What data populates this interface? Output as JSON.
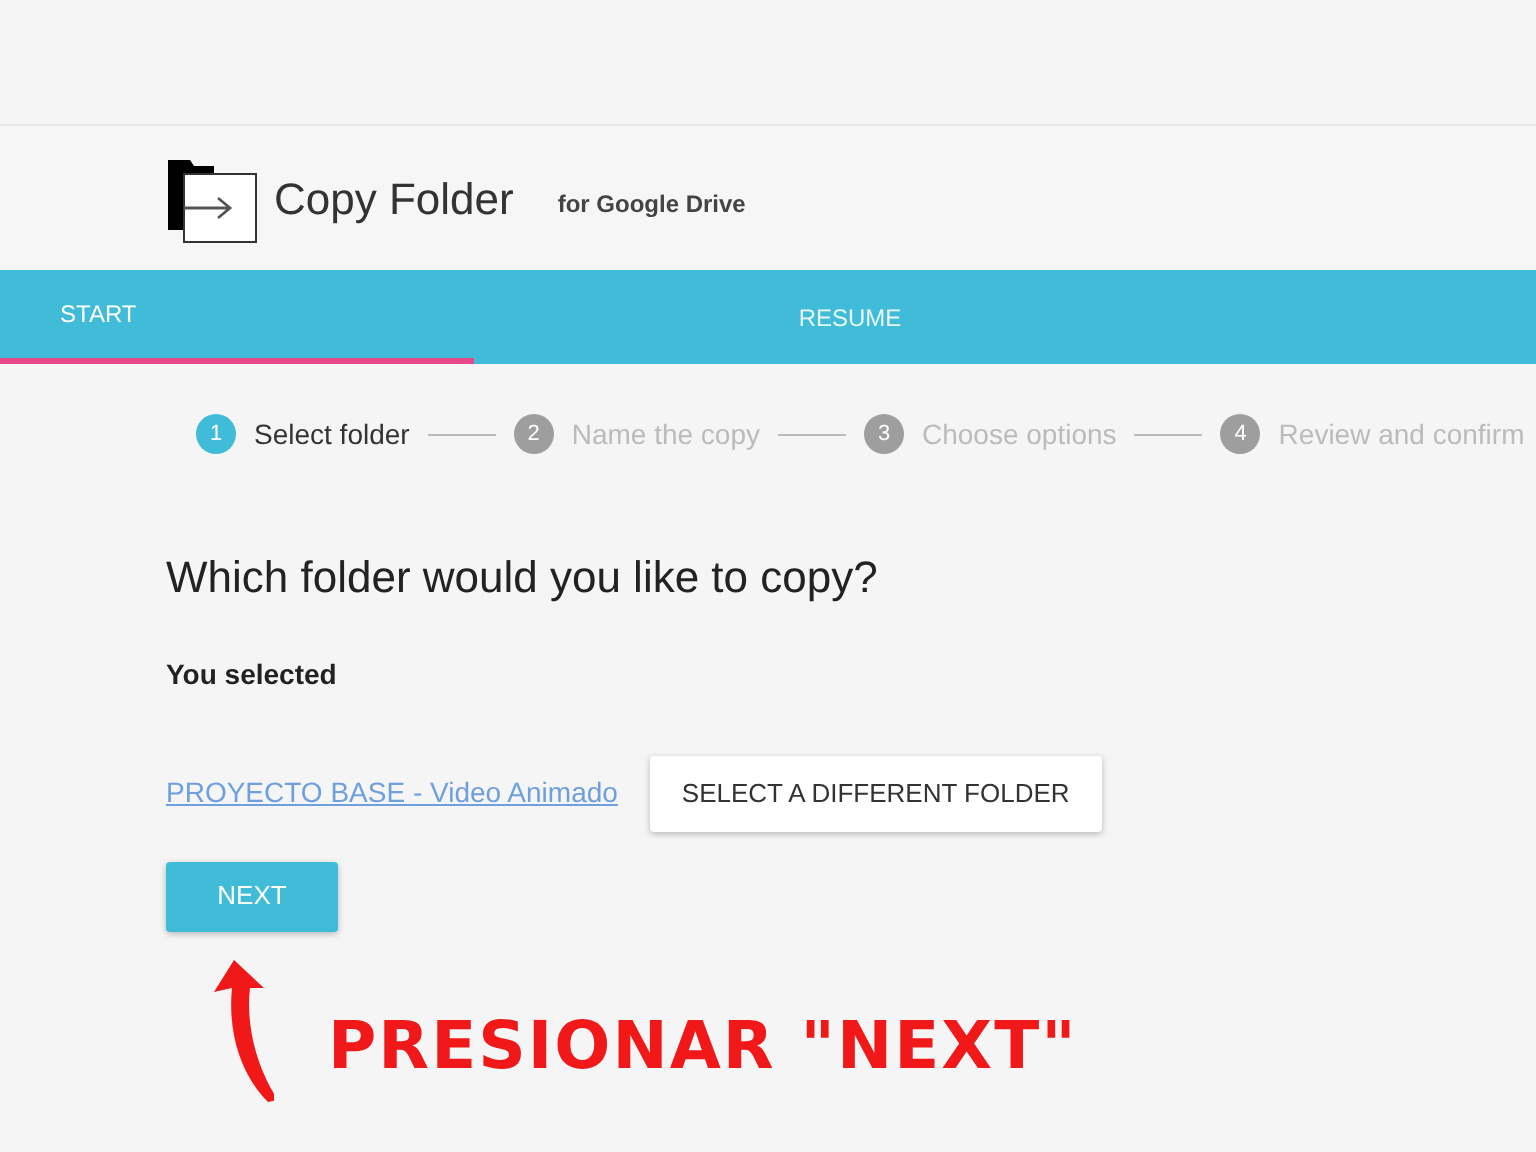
{
  "app": {
    "title": "Copy Folder",
    "subtitle": "for Google Drive"
  },
  "tabs": [
    {
      "label": "START",
      "selected": true
    },
    {
      "label": "RESUME",
      "selected": false
    }
  ],
  "steps": [
    {
      "number": "1",
      "label": "Select folder",
      "selected": true
    },
    {
      "number": "2",
      "label": "Name the copy",
      "selected": false
    },
    {
      "number": "3",
      "label": "Choose options",
      "selected": false
    },
    {
      "number": "4",
      "label": "Review and confirm",
      "selected": false
    }
  ],
  "heading": "Which folder would you like to copy?",
  "selected_label": "You selected",
  "folder_link": "PROYECTO BASE - Video Animado",
  "change_button": "SELECT A DIFFERENT FOLDER",
  "next_button": "NEXT",
  "annotation": {
    "text": "PRESIONAR \"NEXT\""
  }
}
